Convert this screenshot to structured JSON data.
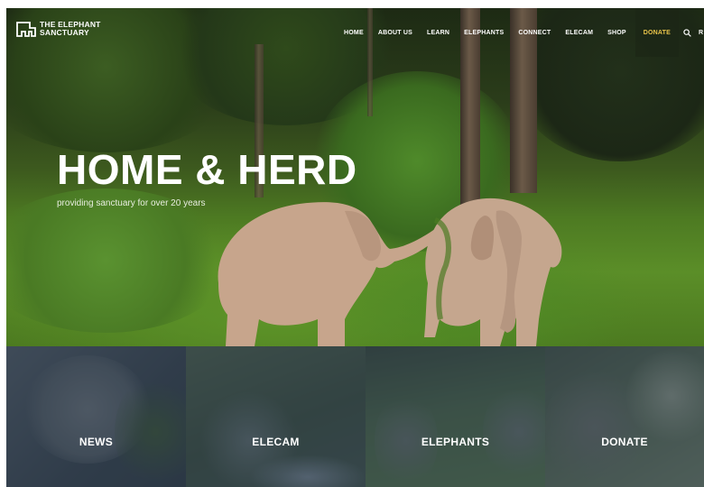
{
  "brand": {
    "line1": "THE ELEPHANT",
    "line2": "SANCTUARY"
  },
  "nav": {
    "items": [
      "HOME",
      "ABOUT US",
      "LEARN",
      "ELEPHANTS",
      "CONNECT",
      "ELECAM",
      "SHOP"
    ],
    "donate": "DONATE",
    "search_icon": "search-icon",
    "cut_item": "R"
  },
  "hero": {
    "title": "HOME & HERD",
    "subtitle": "providing sanctuary for over 20 years"
  },
  "tiles": [
    "NEWS",
    "ELECAM",
    "ELEPHANTS",
    "DONATE"
  ],
  "colors": {
    "donate_accent": "#e9c44a",
    "tile_overlay": "#283646"
  }
}
